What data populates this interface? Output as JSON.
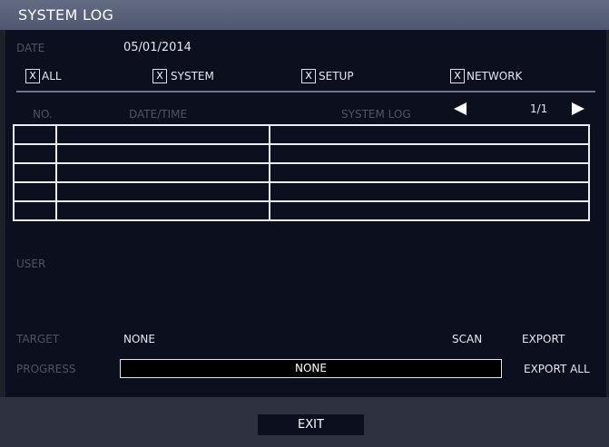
{
  "window": {
    "title": "SYSTEM LOG"
  },
  "date": {
    "label": "DATE",
    "value": "05/01/2014"
  },
  "filters": [
    {
      "mark": "X",
      "label": "ALL"
    },
    {
      "mark": "X",
      "label": "SYSTEM"
    },
    {
      "mark": "X",
      "label": "SETUP"
    },
    {
      "mark": "X",
      "label": "NETWORK"
    }
  ],
  "log_table": {
    "columns": [
      "NO.",
      "DATE/TIME",
      "SYSTEM LOG"
    ],
    "rows": [
      [
        "",
        "",
        ""
      ],
      [
        "",
        "",
        ""
      ],
      [
        "",
        "",
        ""
      ],
      [
        "",
        "",
        ""
      ],
      [
        "",
        "",
        ""
      ]
    ],
    "page": "1/1"
  },
  "user": {
    "label": "USER"
  },
  "target": {
    "label": "TARGET",
    "value": "NONE"
  },
  "actions": {
    "scan": "SCAN",
    "export": "EXPORT",
    "export_all": "EXPORT ALL"
  },
  "progress": {
    "label": "PROGRESS",
    "value": "NONE"
  },
  "footer": {
    "exit": "EXIT"
  },
  "colors": {
    "title_bar": "#5a617a",
    "panel_bg": "#0b0f1e",
    "footer_bg": "#2d3140",
    "dim_text": "#4f5566",
    "text": "#e6e8ee"
  },
  "icons": {
    "prev_page": "triangle-left-icon",
    "next_page": "triangle-right-icon"
  }
}
